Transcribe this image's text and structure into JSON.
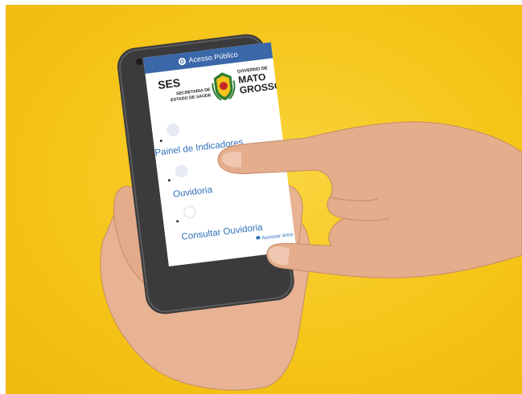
{
  "header": {
    "title": "Acesso Público"
  },
  "logo": {
    "ses": "SES",
    "ses_sub_1": "SECRETARIA DE",
    "ses_sub_2": "ESTADO DE SAÚDE",
    "gov_top": "GOVERNO DE",
    "gov_line_1": "MATO",
    "gov_line_2": "GROSSO"
  },
  "menu": {
    "items": [
      {
        "label": "Painel de Indicadores",
        "icon": "chart-icon"
      },
      {
        "label": "Ouvidoria",
        "icon": "people-icon"
      },
      {
        "label": "Consultar Ouvidoria",
        "icon": "search-icon"
      }
    ]
  },
  "restricted_link": {
    "label": "Acessar área"
  },
  "colors": {
    "background_yellow": "#f5c518",
    "header_blue": "#3a67a8",
    "link_blue": "#2f6fb8",
    "phone_body": "#3b3b3d"
  }
}
